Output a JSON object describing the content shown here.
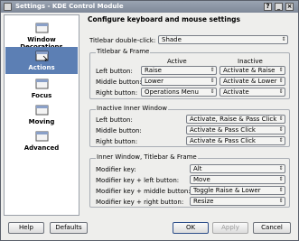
{
  "window": {
    "title": "Settings - KDE Control Module"
  },
  "sidebar": {
    "items": [
      {
        "label": "Window Decorations",
        "icon": "window-decorations-icon",
        "active": false
      },
      {
        "label": "Actions",
        "icon": "actions-icon",
        "active": true
      },
      {
        "label": "Focus",
        "icon": "focus-icon",
        "active": false
      },
      {
        "label": "Moving",
        "icon": "moving-icon",
        "active": false
      },
      {
        "label": "Advanced",
        "icon": "advanced-icon",
        "active": false
      }
    ]
  },
  "main": {
    "title": "Configure keyboard and mouse settings",
    "titlebar_dblclick": {
      "label": "Titlebar double-click:",
      "value": "Shade"
    },
    "titlebar_frame": {
      "title": "Titlebar & Frame",
      "col_active": "Active",
      "col_inactive": "Inactive",
      "rows": [
        {
          "label": "Left button:",
          "active": "Raise",
          "inactive": "Activate & Raise"
        },
        {
          "label": "Middle button:",
          "active": "Lower",
          "inactive": "Activate & Lower"
        },
        {
          "label": "Right button:",
          "active": "Operations Menu",
          "inactive": "Activate"
        }
      ]
    },
    "inactive_inner": {
      "title": "Inactive Inner Window",
      "rows": [
        {
          "label": "Left button:",
          "value": "Activate, Raise & Pass Click"
        },
        {
          "label": "Middle button:",
          "value": "Activate & Pass Click"
        },
        {
          "label": "Right button:",
          "value": "Activate & Pass Click"
        }
      ]
    },
    "inner_titlebar_frame": {
      "title": "Inner Window, Titlebar & Frame",
      "rows": [
        {
          "label": "Modifier key:",
          "value": "Alt"
        },
        {
          "label": "Modifier key + left button:",
          "value": "Move"
        },
        {
          "label": "Modifier key + middle button:",
          "value": "Toggle Raise & Lower"
        },
        {
          "label": "Modifier key + right button:",
          "value": "Resize"
        }
      ]
    }
  },
  "buttons": {
    "help": "Help",
    "defaults": "Defaults",
    "ok": "OK",
    "apply": "Apply",
    "cancel": "Cancel"
  },
  "colors": {
    "accent": "#5c7fb4",
    "titlebar": "#8a93a2"
  }
}
